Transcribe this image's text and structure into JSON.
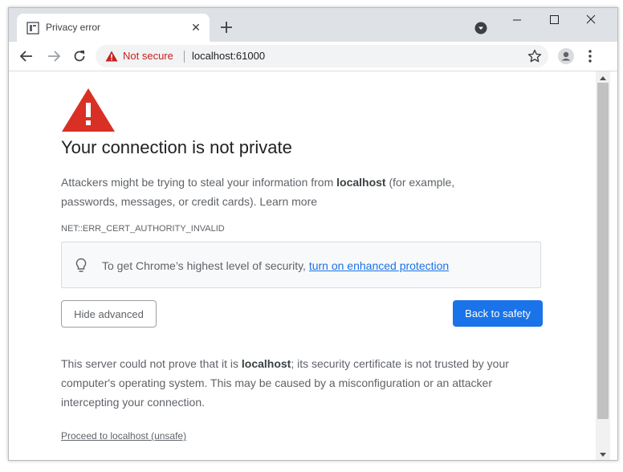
{
  "tab": {
    "title": "Privacy error"
  },
  "omnibox": {
    "security_label": "Not secure",
    "url": "localhost:61000"
  },
  "page": {
    "heading": "Your connection is not private",
    "intro_before": "Attackers might be trying to steal your information from ",
    "intro_host": "localhost",
    "intro_after": " (for example, passwords, messages, or credit cards). ",
    "learn_more": "Learn more",
    "error_code": "NET::ERR_CERT_AUTHORITY_INVALID",
    "enhanced_text": "To get Chrome’s highest level of security, ",
    "enhanced_link": "turn on enhanced protection",
    "hide_advanced": "Hide advanced",
    "back_to_safety": "Back to safety",
    "details_before": "This server could not prove that it is ",
    "details_host": "localhost",
    "details_after": "; its security certificate is not trusted by your computer's operating system. This may be caused by a misconfiguration or an attacker intercepting your connection.",
    "proceed": "Proceed to localhost (unsafe)"
  },
  "colors": {
    "accent": "#1a73e8",
    "danger": "#d93025",
    "not_secure": "#c5221f"
  }
}
